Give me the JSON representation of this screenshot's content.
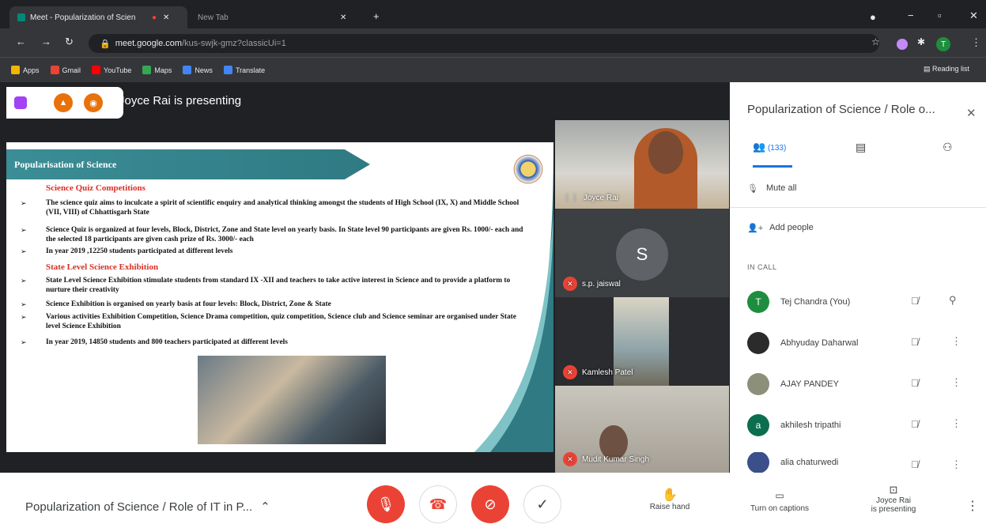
{
  "browser": {
    "tabs": [
      {
        "label": "Meet - Popularization of Scien"
      },
      {
        "label": "New Tab"
      }
    ],
    "url_host": "meet.google.com",
    "url_path": "/kus-swjk-gmz?classicUi=1",
    "bookmarks": [
      "Apps",
      "Gmail",
      "YouTube",
      "Maps",
      "News",
      "Translate"
    ],
    "reading_list": "Reading list",
    "profile_initial": "T"
  },
  "meet": {
    "presenting_text": "Joyce Rai is presenting",
    "slide": {
      "title": "Popularisation of Science",
      "heading1": "Science Quiz Competitions",
      "bullets1": [
        "The science quiz aims to inculcate a spirit of scientific enquiry and analytical thinking amongst the students of High School (IX, X) and Middle School (VII, VIII) of Chhattisgarh State",
        "Science Quiz is organized at four levels, Block, District, Zone and State level on yearly basis. In State level 90 participants are given Rs. 1000/- each and the selected 18 participants are given cash prize of Rs. 3000/- each",
        "In year 2019 ,12250 students participated at different levels"
      ],
      "heading2": "State Level Science Exhibition",
      "bullets2": [
        "State Level Science Exhibition stimulate students from standard IX -XII and teachers to take active interest in Science and to provide a platform to nurture their creativity",
        "Science Exhibition is organised on yearly basis at four levels: Block, District, Zone & State",
        "Various activities Exhibition Competition, Science Drama competition, quiz competition, Science club and Science seminar are organised under State level Science Exhibition",
        "In year 2019, 14850 students and 800 teachers participated at different levels"
      ]
    },
    "tiles": [
      {
        "name": "Joyce Rai"
      },
      {
        "name": "s.p. jaiswal",
        "initial": "S"
      },
      {
        "name": "Kamlesh Patel"
      },
      {
        "name": "Mudit Kumar Singh"
      }
    ]
  },
  "panel": {
    "title": "Popularization of Science / Role o...",
    "people_count": "(133)",
    "mute_all": "Mute all",
    "add_people": "Add people",
    "in_call": "IN CALL",
    "participants": [
      {
        "name": "Tej Chandra (You)",
        "initial": "T",
        "color": "#1e8e3e"
      },
      {
        "name": "Abhyuday Daharwal",
        "initial": "",
        "color": "#2b2b2b"
      },
      {
        "name": "AJAY PANDEY",
        "initial": "",
        "color": "#8c8f7a"
      },
      {
        "name": "akhilesh tripathi",
        "initial": "a",
        "color": "#0b6e4f"
      },
      {
        "name": "alia chaturwedi",
        "initial": "",
        "color": "#3b4f8a"
      }
    ]
  },
  "bottom": {
    "meeting_title": "Popularization of Science / Role of IT in P...",
    "raise_hand": "Raise hand",
    "captions": "Turn on captions",
    "presenting_line1": "Joyce Rai",
    "presenting_line2": "is presenting"
  },
  "colors": {
    "red": "#ea4335",
    "teal": "#3b8d96",
    "dark": "#202124"
  }
}
